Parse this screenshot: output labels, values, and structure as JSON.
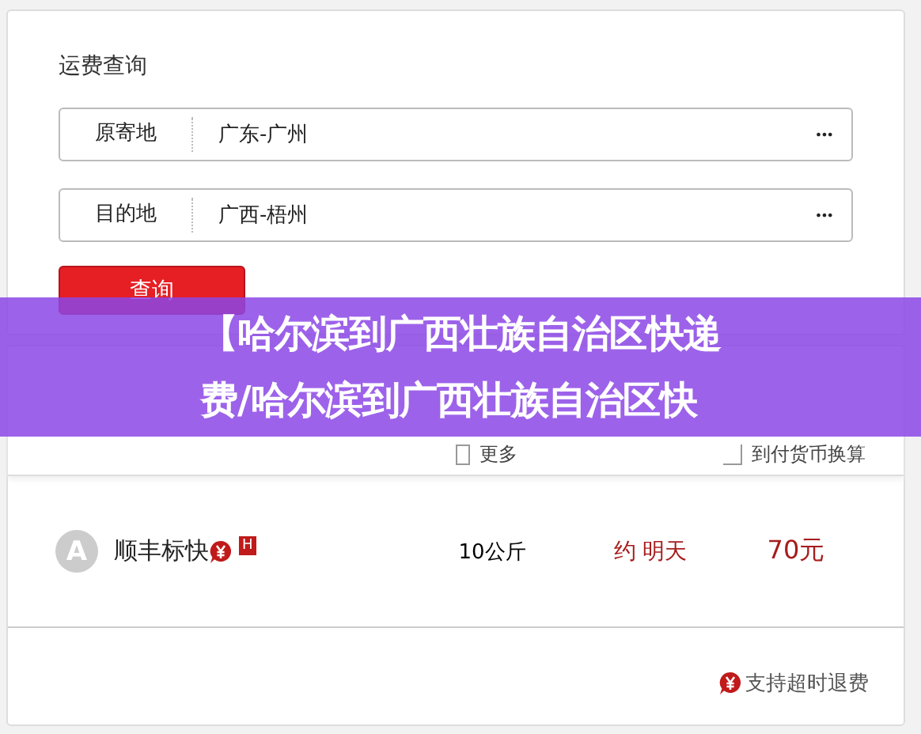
{
  "query_panel": {
    "title": "运费查询",
    "fields": [
      {
        "label": "原寄地",
        "value": "广东-广州",
        "more": "•••"
      },
      {
        "label": "目的地",
        "value": "广西-梧州",
        "more": "•••"
      }
    ],
    "button": "查询"
  },
  "results": {
    "header_links": [
      {
        "kind": "list",
        "label": "更多"
      },
      {
        "kind": "currency",
        "label": "到付货币换算"
      }
    ],
    "rows": [
      {
        "avatar": "A",
        "name": "顺丰标快",
        "badge": "H",
        "weight": "10公斤",
        "eta": "约 明天",
        "price": "70元"
      }
    ],
    "footer": "支持超时退费"
  },
  "banner": {
    "lines": [
      "【哈尔滨到广西壮族自治区快递",
      "费/哈尔滨到广西壮族自治区快"
    ]
  }
}
